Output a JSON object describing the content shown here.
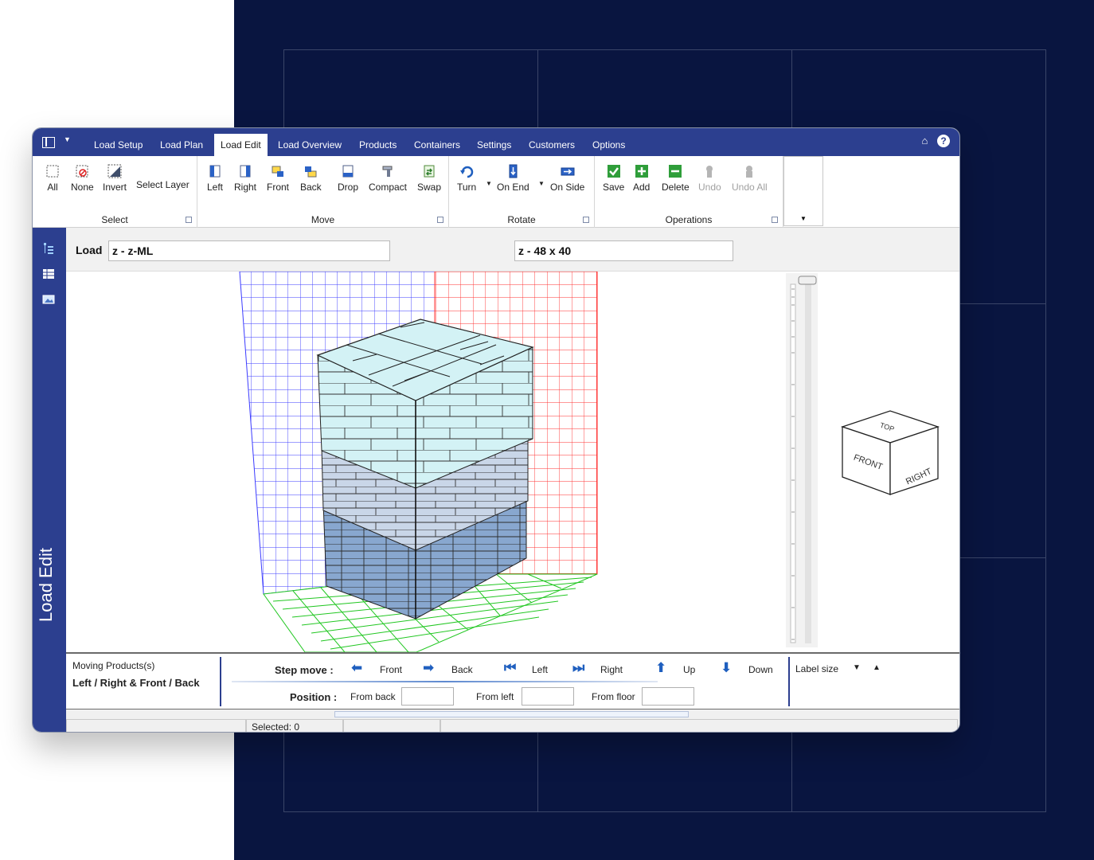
{
  "tabs": [
    {
      "label": "Load Setup",
      "active": false
    },
    {
      "label": "Load Plan",
      "active": false
    },
    {
      "label": "Load Edit",
      "active": true
    },
    {
      "label": "Load Overview",
      "active": false
    },
    {
      "label": "Products",
      "active": false
    },
    {
      "label": "Containers",
      "active": false
    },
    {
      "label": "Settings",
      "active": false
    },
    {
      "label": "Customers",
      "active": false
    },
    {
      "label": "Options",
      "active": false
    }
  ],
  "ribbon": {
    "select": {
      "label": "Select",
      "all": "All",
      "none": "None",
      "invert": "Invert",
      "select_layer": "Select Layer"
    },
    "move": {
      "label": "Move",
      "left": "Left",
      "right": "Right",
      "front": "Front",
      "back": "Back",
      "drop": "Drop",
      "compact": "Compact",
      "swap": "Swap"
    },
    "rotate": {
      "label": "Rotate",
      "turn": "Turn",
      "on_end": "On End",
      "on_side": "On Side"
    },
    "operations": {
      "label": "Operations",
      "save": "Save",
      "add": "Add",
      "delete": "Delete",
      "undo": "Undo",
      "undo_all": "Undo All"
    }
  },
  "sidebar": {
    "title": "Load Edit"
  },
  "loadbar": {
    "label": "Load",
    "load_name": "z - z-ML",
    "pallet": "z - 48 x 40"
  },
  "viewcube": {
    "top": "TOP",
    "front": "FRONT",
    "right": "RIGHT"
  },
  "stepbar": {
    "moving_title": "Moving Products(s)",
    "moving_mode": "Left / Right & Front / Back",
    "step_move": "Step move :",
    "front": "Front",
    "back": "Back",
    "left": "Left",
    "right": "Right",
    "up": "Up",
    "down": "Down",
    "position": "Position :",
    "from_back": "From back",
    "from_left": "From left",
    "from_floor": "From floor",
    "label_size": "Label size"
  },
  "status": {
    "selected": "Selected: 0"
  },
  "colors": {
    "brand": "#2c3f8f",
    "background": "#091540",
    "top_boxes": "#d3f2f5",
    "mid_boxes": "#c9d6e8",
    "low_boxes": "#88a7cf"
  }
}
